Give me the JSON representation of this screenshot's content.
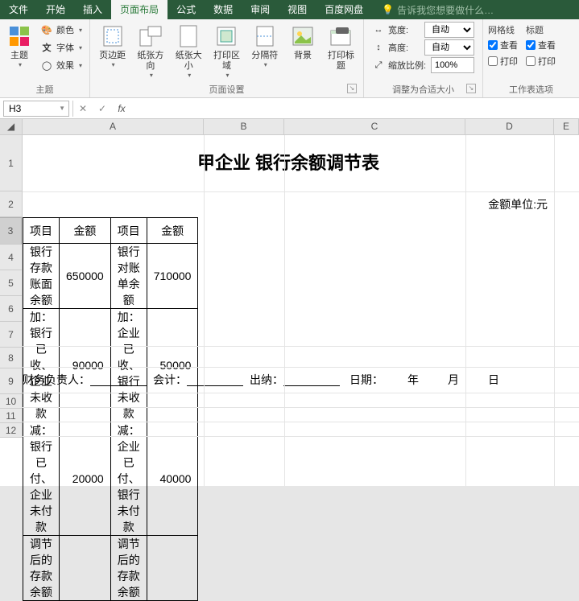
{
  "menu": {
    "file": "文件",
    "home": "开始",
    "insert": "插入",
    "layout": "页面布局",
    "formula": "公式",
    "data": "数据",
    "review": "审阅",
    "view": "视图",
    "baidu": "百度网盘",
    "hint": "告诉我您想要做什么…"
  },
  "ribbon": {
    "themes": {
      "label": "主题",
      "theme": "主题",
      "colors": "颜色",
      "fonts": "字体",
      "effects": "效果"
    },
    "pagesetup": {
      "label": "页面设置",
      "margins": "页边距",
      "orient": "纸张方向",
      "size": "纸张大小",
      "area": "打印区域",
      "breaks": "分隔符",
      "bg": "背景",
      "titles": "打印标题"
    },
    "scale": {
      "label": "调整为合适大小",
      "width": "宽度:",
      "height": "高度:",
      "auto": "自动",
      "scale_l": "缩放比例:",
      "scale_v": "100%"
    },
    "sheetopts": {
      "label": "工作表选项",
      "grid": "网格线",
      "head": "标题",
      "view": "查看",
      "print": "打印"
    }
  },
  "fbar": {
    "ref": "H3",
    "fx": "fx"
  },
  "cols": {
    "A": "A",
    "B": "B",
    "C": "C",
    "D": "D",
    "E": "E"
  },
  "rows": {
    "1": "1",
    "2": "2",
    "3": "3",
    "4": "4",
    "5": "5",
    "6": "6",
    "7": "7",
    "8": "8",
    "9": "9",
    "10": "10",
    "11": "11",
    "12": "12"
  },
  "sheetdata": {
    "title": "甲企业 银行余额调节表",
    "unit": "金额单位:元",
    "h1": "项目",
    "h2": "金额",
    "h3": "项目",
    "h4": "金额",
    "r1c1": "银行存款账面余额",
    "r1c2": "650000",
    "r1c3": "银行对账单余额",
    "r1c4": "710000",
    "r2c1": "加：银行已收、企业未收款",
    "r2c2": "90000",
    "r2c3": "加：企业已收、银行未收款",
    "r2c4": "50000",
    "r3c1": "减：银行已付、企业未付款",
    "r3c2": "20000",
    "r3c3": "减：企业已付、银行未付款",
    "r3c4": "40000",
    "r4c1": "调节后的存款余额",
    "r4c3": "调节后的存款余额",
    "sig": {
      "resp": "财务负责人：",
      "acct": "会计：",
      "cashier": "出纳：",
      "date": "日期：",
      "y": "年",
      "m": "月",
      "d": "日"
    }
  },
  "chart_data": {
    "type": "table",
    "title": "甲企业 银行余额调节表",
    "unit": "金额单位:元",
    "columns": [
      "项目",
      "金额",
      "项目",
      "金额"
    ],
    "rows": [
      [
        "银行存款账面余额",
        650000,
        "银行对账单余额",
        710000
      ],
      [
        "加：银行已收、企业未收款",
        90000,
        "加：企业已收、银行未收款",
        50000
      ],
      [
        "减：银行已付、企业未付款",
        20000,
        "减：企业已付、银行未付款",
        40000
      ],
      [
        "调节后的存款余额",
        null,
        "调节后的存款余额",
        null
      ]
    ]
  }
}
